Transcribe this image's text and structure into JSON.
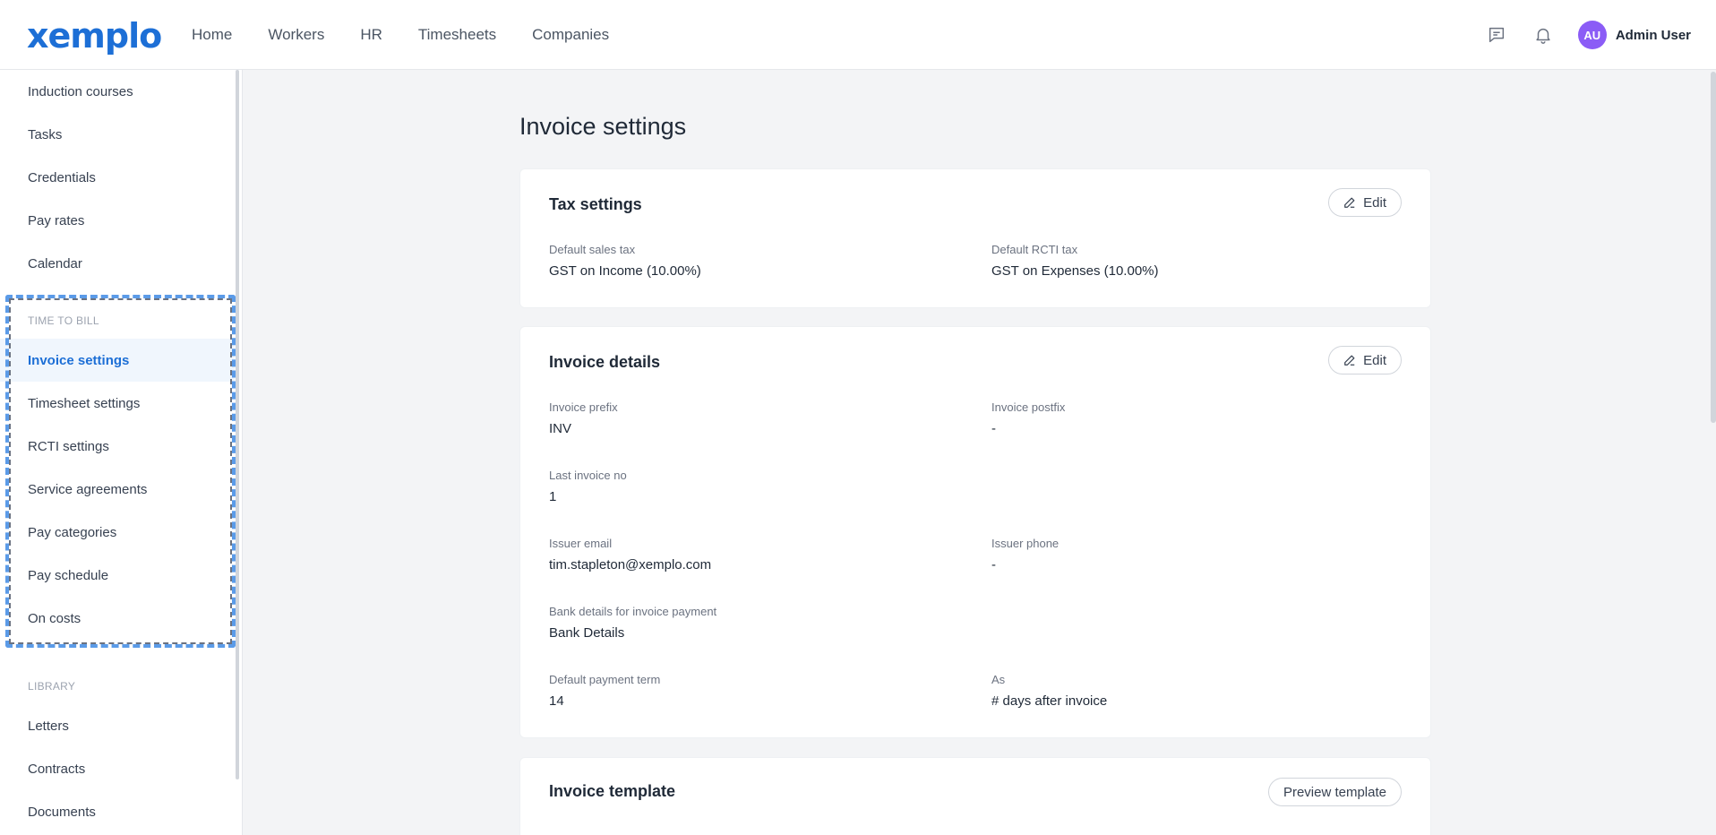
{
  "brand": {
    "logo_text": "xemplo",
    "accent": "#1d6fd6"
  },
  "nav": {
    "items": [
      "Home",
      "Workers",
      "HR",
      "Timesheets",
      "Companies"
    ]
  },
  "topbar": {
    "icons": [
      "chat-icon",
      "bell-icon"
    ],
    "avatar_initials": "AU",
    "user_name": "Admin User",
    "avatar_color": "#8b5cf6"
  },
  "sidebar": {
    "top_items": [
      "Induction courses",
      "Tasks",
      "Credentials",
      "Pay rates",
      "Calendar"
    ],
    "time_to_bill": {
      "heading": "TIME TO BILL",
      "items": [
        "Invoice settings",
        "Timesheet settings",
        "RCTI settings",
        "Service agreements",
        "Pay categories",
        "Pay schedule",
        "On costs"
      ],
      "active": "Invoice settings"
    },
    "library": {
      "heading": "LIBRARY",
      "items": [
        "Letters",
        "Contracts",
        "Documents"
      ]
    }
  },
  "page": {
    "title": "Invoice settings"
  },
  "tax_settings": {
    "title": "Tax settings",
    "edit_label": "Edit",
    "default_sales_tax_label": "Default sales tax",
    "default_sales_tax_value": "GST on Income (10.00%)",
    "default_rcti_tax_label": "Default RCTI tax",
    "default_rcti_tax_value": "GST on Expenses (10.00%)"
  },
  "invoice_details": {
    "title": "Invoice details",
    "edit_label": "Edit",
    "prefix_label": "Invoice prefix",
    "prefix_value": "INV",
    "postfix_label": "Invoice postfix",
    "postfix_value": "-",
    "last_no_label": "Last invoice no",
    "last_no_value": "1",
    "issuer_email_label": "Issuer email",
    "issuer_email_value": "tim.stapleton@xemplo.com",
    "issuer_phone_label": "Issuer phone",
    "issuer_phone_value": "-",
    "bank_label": "Bank details for invoice payment",
    "bank_value": "Bank Details",
    "payment_term_label": "Default payment term",
    "payment_term_value": "14",
    "as_label": "As",
    "as_value": "# days after invoice"
  },
  "invoice_template": {
    "title": "Invoice template",
    "preview_label": "Preview template"
  }
}
